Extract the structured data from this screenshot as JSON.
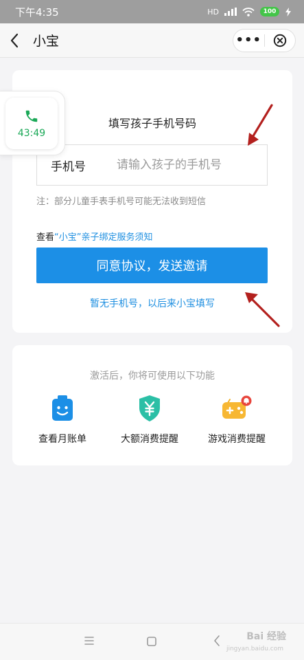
{
  "status": {
    "time": "下午4:35",
    "network": "HD",
    "battery": "100",
    "icons": [
      "signal-icon",
      "wifi-icon",
      "battery-icon",
      "charging-icon"
    ]
  },
  "nav": {
    "title": "小宝",
    "back_icon": "chevron-left-icon",
    "more_label": "•••",
    "close_icon": "close-circle-icon"
  },
  "form": {
    "title": "填写孩子手机号码",
    "phone_label": "手机号",
    "phone_placeholder": "请输入孩子的手机号",
    "phone_value": "",
    "note": "注：部分儿童手表手机号可能无法收到短信",
    "agree_prefix": "查看",
    "agree_link": "“小宝”亲子绑定服务须知",
    "send_button": "同意协议，发送邀请",
    "later_link": "暂无手机号，以后来小宝填写"
  },
  "features": {
    "title": "激活后，你将可使用以下功能",
    "items": [
      {
        "label": "查看月账单",
        "icon": "smiley-bag-icon"
      },
      {
        "label": "大额消费提醒",
        "icon": "yuan-shield-icon"
      },
      {
        "label": "游戏消费提醒",
        "icon": "gamepad-icon"
      }
    ]
  },
  "call": {
    "duration": "43:49",
    "icon": "phone-icon"
  },
  "bottom": {
    "watermark": "Bai 经验",
    "watermark_sub": "jingyan.baidu.com"
  },
  "colors": {
    "accent": "#1c8fe6",
    "link": "#1c8ee0",
    "call_green": "#1aa857",
    "arrow_red": "#b3201e"
  }
}
